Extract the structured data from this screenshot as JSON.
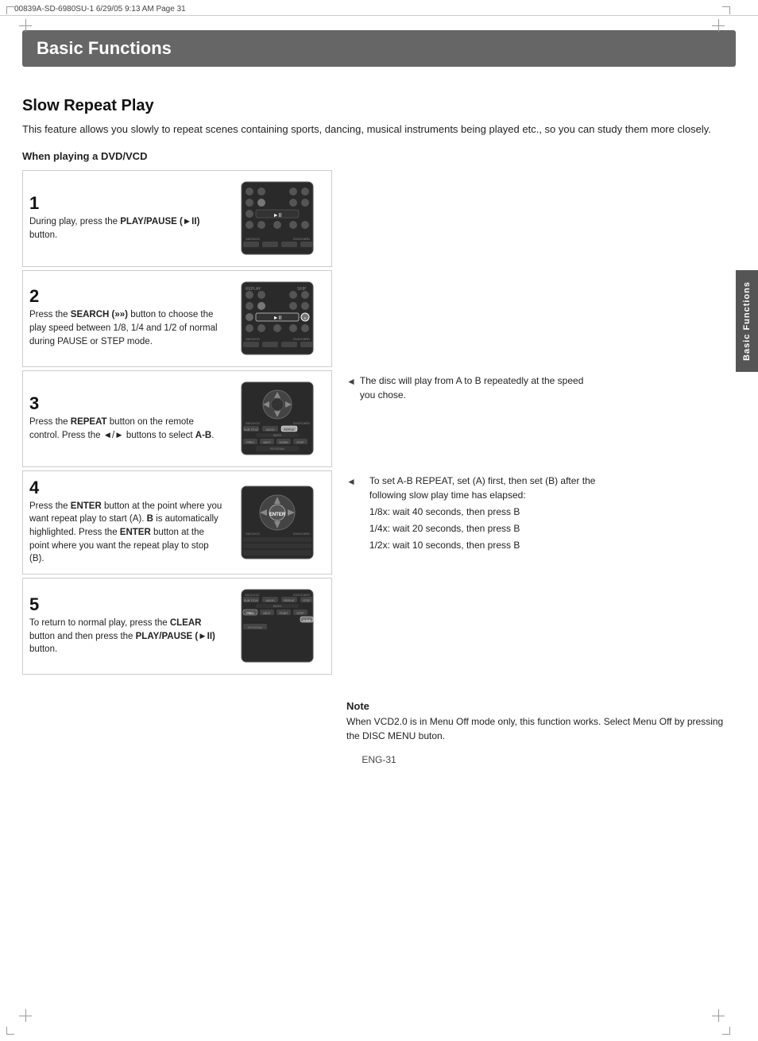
{
  "file_info": {
    "left": "00839A-SD-6980SU-1   6/29/05   9:13 AM   Page 31",
    "right": ""
  },
  "title_banner": {
    "text": "Basic Functions"
  },
  "section": {
    "title": "Slow Repeat Play",
    "intro": "This feature allows you slowly to repeat scenes containing sports, dancing, musical instruments being played etc., so you can study them more closely.",
    "subsection_label": "When playing a DVD/VCD"
  },
  "steps": [
    {
      "number": "1",
      "description": "During play, press the PLAY/PAUSE (►II) button."
    },
    {
      "number": "2",
      "description": "Press the SEARCH (»») button to choose the play speed between 1/8, 1/4 and 1/2 of normal during PAUSE or STEP mode."
    },
    {
      "number": "3",
      "description": "Press the REPEAT button on the remote control. Press the ◄/► buttons to select A-B.",
      "note": "The disc will play from A to B repeatedly at the speed you chose."
    },
    {
      "number": "4",
      "description": "Press the ENTER button at the point where you want repeat play to start (A). B is automatically highlighted. Press the ENTER button at the point where you want the repeat play to stop (B).",
      "note_lines": [
        "To set A-B REPEAT, set (A) first, then set (B) after the following slow play time has elapsed:",
        "1/8x: wait 40 seconds, then press B",
        "1/4x: wait 20 seconds, then press B",
        "1/2x: wait 10 seconds, then press B"
      ]
    },
    {
      "number": "5",
      "description": "To return to normal play, press the CLEAR button and then press the PLAY/PAUSE (►II) button."
    }
  ],
  "note_box": {
    "title": "Note",
    "text": "When VCD2.0 is in Menu Off mode only, this function works. Select Menu Off by pressing the DISC MENU buton."
  },
  "page_number": "ENG-31",
  "side_tab": "Basic Functions"
}
